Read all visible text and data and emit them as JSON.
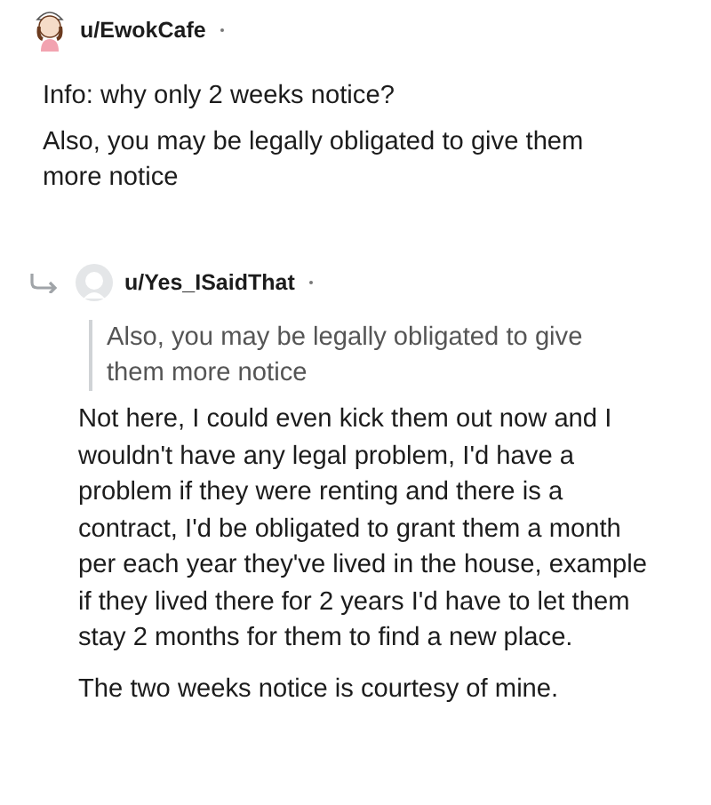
{
  "comments": [
    {
      "username": "u/EwokCafe",
      "kind": "top",
      "paragraphs": [
        "Info: why only 2 weeks notice?",
        "Also, you may be legally obligated to give them more notice"
      ]
    },
    {
      "username": "u/Yes_ISaidThat",
      "kind": "reply",
      "quote": "Also, you may be legally obligated to give them more notice",
      "paragraphs": [
        "Not here, I could even kick them out now and I wouldn't have any legal problem, I'd have a problem if they were renting and there is a contract, I'd be obligated to grant them a month per each year they've lived in the house, example if they lived there for 2 years I'd have to let them stay 2 months for them to find a new place.",
        "The two weeks notice is courtesy of mine."
      ]
    }
  ]
}
